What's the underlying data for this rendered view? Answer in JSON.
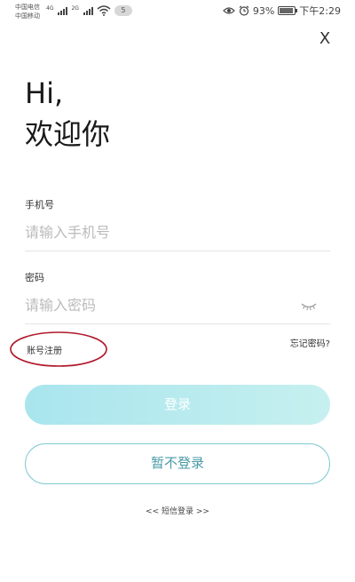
{
  "status_bar": {
    "carrier_1": "中国电信",
    "carrier_2": "中国移动",
    "net_type_1": "4G",
    "net_type_2": "2G",
    "notification_count": "5",
    "battery_percent": "93%",
    "battery_level": 0.93,
    "time": "下午2:29"
  },
  "close_label": "X",
  "greeting": {
    "line1": "Hi,",
    "line2": "欢迎你"
  },
  "phone": {
    "label": "手机号",
    "placeholder": "请输入手机号"
  },
  "password": {
    "label": "密码",
    "placeholder": "请输入密码"
  },
  "links": {
    "register": "账号注册",
    "forgot_password": "忘记密码?",
    "sms_login": "<< 短信登录 >>"
  },
  "buttons": {
    "login": "登录",
    "skip_login": "暂不登录"
  },
  "colors": {
    "login_button": "#a9e5ee",
    "skip_border": "#7fc9d3",
    "annotation": "#b0182a"
  }
}
